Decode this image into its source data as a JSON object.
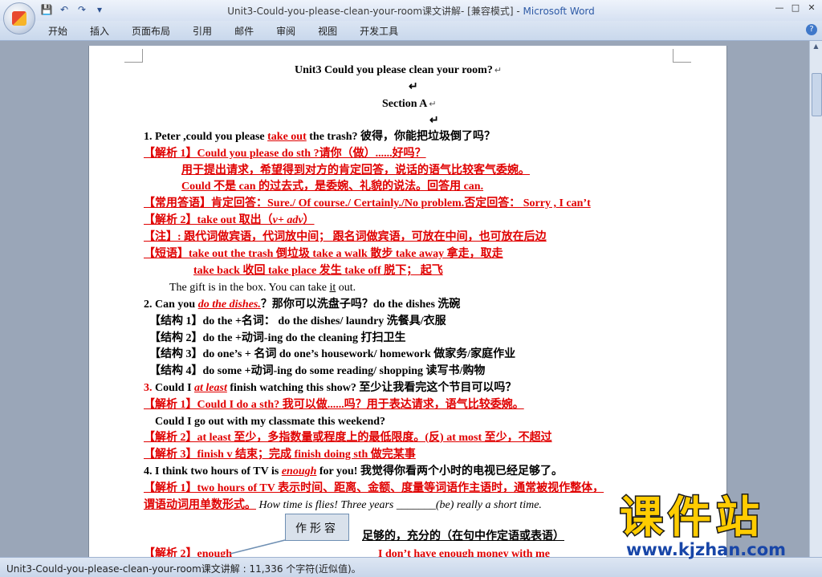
{
  "window": {
    "title": "Unit3-Could-you-please-clean-your-room课文讲解- [兼容模式] - ",
    "app_name": "Microsoft Word",
    "controls": [
      "—",
      "□",
      "✕"
    ]
  },
  "qat": {
    "save": "💾",
    "undo": "↶",
    "redo": "↷",
    "more": "▾"
  },
  "ribbon": {
    "tabs": [
      "开始",
      "插入",
      "页面布局",
      "引用",
      "邮件",
      "审阅",
      "视图",
      "开发工具"
    ],
    "help": "?"
  },
  "document": {
    "title": "Unit3 Could you please clean your room?",
    "section": "Section A",
    "pm": "↵",
    "l1a": "1. Peter ,could you please ",
    "l1b": "take out",
    "l1c": " the trash?  彼得，你能把垃圾倒了吗？",
    "l2": "【解析 1】Could you please do sth ?请你（做）......好吗？",
    "l3": "用于提出请求，希望得到对方的肯定回答，说话的语气比较客气委婉。",
    "l4": "Could  不是 can 的过去式，是委婉、礼貌的说法。回答用 can.",
    "l5": "【常用答语】肯定回答：Sure./ Of course./ Certainly./No problem.否定回答：  Sorry , I can’t",
    "l6a": "【解析 2】take out  取出（",
    "l6b": "v+ adv",
    "l6c": "）",
    "l7": "【注】: 跟代词做宾语，代词放中间；  跟名词做宾语，可放在中间，也可放在后边",
    "l8": "【短语】take out the trash  倒垃圾    take a walk  散步    take away  拿走，取走",
    "l9": "take back  收回        take place  发生       take off      脱下；  起飞",
    "l10a": "The gift is in the box. You can take ",
    "l10b": "it",
    "l10c": " out.",
    "l11a": "2. Can you ",
    "l11b": "do the dishes.",
    "l11c": "？那你可以洗盘子吗？do the dishes  洗碗",
    "l12": "【结构 1】do the +名词：        do the dishes/ laundry  洗餐具/衣服",
    "l13": "【结构 2】do the +动词-ing      do the cleaning  打扫卫生",
    "l14": "【结构 3】do one’s +  名词       do one’s housework/ homework  做家务/家庭作业",
    "l15": "【结构 4】do some +动词-ing    do some reading/ shopping     读写书/购物",
    "l16a": "3. ",
    "l16b": "Could I ",
    "l16c": "at least",
    "l16d": " finish watching this show?  至少让我看完这个节目可以吗？",
    "l17": "【解析 1】Could I do a sth?  我可以做......吗？用于表达请求，语气比较委婉。",
    "l18": "Could I    go out with my classmate  this weekend?",
    "l19": "【解析 2】at least  至少，多指数量或程度上的最低限度。(反) at most  至少，不超过",
    "l20": "【解析 3】finish v  结束；完成  finish doing  sth  做完某事",
    "l21a": "4. I think two hours of TV is ",
    "l21b": "enough",
    "l21c": " for you!  我觉得你看两个小时的电视已经足够了。",
    "l22": "【解析 1】two hours of TV 表示时间、距离、金额、度量等词语作主语时，通常被视作整体，",
    "l23a": "谓语动词用单数形式。",
    "l23b": "  How time is flies! Three years _______(be) really  a short time.",
    "l24": "足够的，充分的（在句中作定语或表语）",
    "l25a": "【解析 2】enough",
    "l25b": "I don’t have enough money  with me"
  },
  "callout": {
    "text": "作形容"
  },
  "watermark": {
    "cn": "课件站",
    "url": "www.kjzhan.com"
  },
  "status": {
    "text": "Unit3-Could-you-please-clean-your-room课文讲解 : 11,336 个字符(近似值)。"
  }
}
